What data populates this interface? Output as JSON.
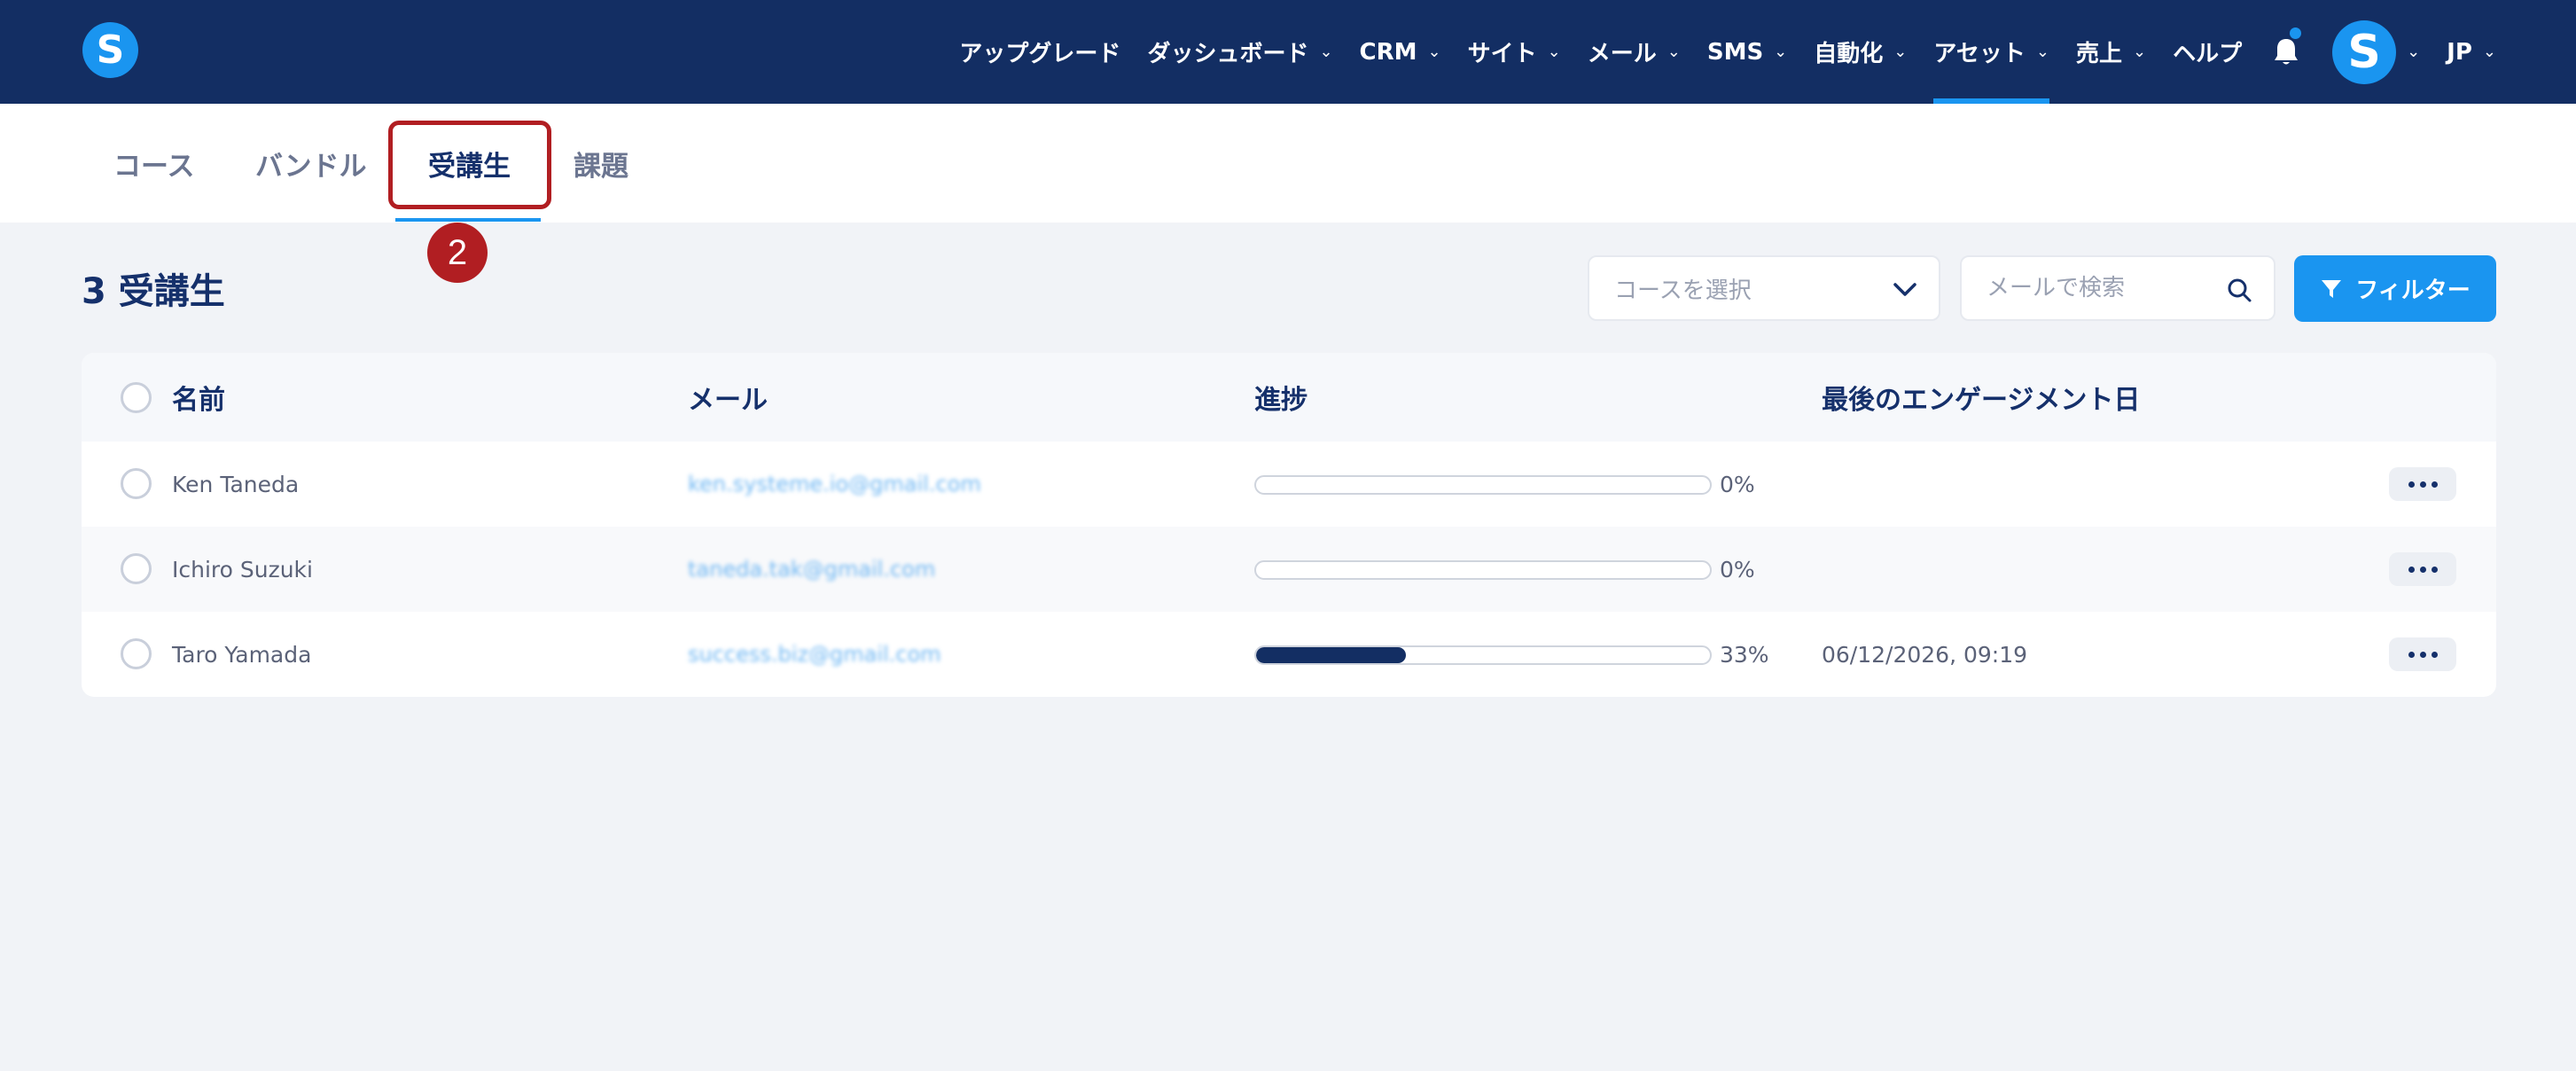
{
  "topbar": {
    "logo_letter": "S",
    "nav": [
      {
        "label": "アップグレード",
        "dropdown": false
      },
      {
        "label": "ダッシュボード",
        "dropdown": true
      },
      {
        "label": "CRM",
        "dropdown": true
      },
      {
        "label": "サイト",
        "dropdown": true
      },
      {
        "label": "メール",
        "dropdown": true
      },
      {
        "label": "SMS",
        "dropdown": true
      },
      {
        "label": "自動化",
        "dropdown": true
      },
      {
        "label": "アセット",
        "dropdown": true,
        "active": true
      },
      {
        "label": "売上",
        "dropdown": true
      },
      {
        "label": "ヘルプ",
        "dropdown": false
      }
    ],
    "avatar_letter": "S",
    "language": "JP",
    "notification_icon": "bell-icon"
  },
  "tabs": [
    {
      "label": "コース",
      "active": false
    },
    {
      "label": "バンドル",
      "active": false
    },
    {
      "label": "受講生",
      "active": true
    },
    {
      "label": "課題",
      "active": false
    }
  ],
  "annotation": {
    "step_number": "2"
  },
  "header": {
    "title": "3 受講生",
    "course_select_placeholder": "コースを選択",
    "search_placeholder": "メールで検索",
    "filter_label": "フィルター"
  },
  "table": {
    "columns": {
      "name": "名前",
      "email": "メール",
      "progress": "進捗",
      "last_engagement": "最後のエンゲージメント日"
    },
    "rows": [
      {
        "name": "Ken Taneda",
        "email": "ken.systeme.io@gmail.com",
        "progress": 0,
        "progress_label": "0%",
        "last_engagement": ""
      },
      {
        "name": "Ichiro Suzuki",
        "email": "taneda.tak@gmail.com",
        "progress": 0,
        "progress_label": "0%",
        "last_engagement": ""
      },
      {
        "name": "Taro Yamada",
        "email": "success.biz@gmail.com",
        "progress": 33,
        "progress_label": "33%",
        "last_engagement": "06/12/2026, 09:19"
      }
    ]
  },
  "colors": {
    "nav_bg": "#132e63",
    "accent": "#1a95f0",
    "annotation": "#b11e22",
    "progress_fill": "#132e63"
  }
}
